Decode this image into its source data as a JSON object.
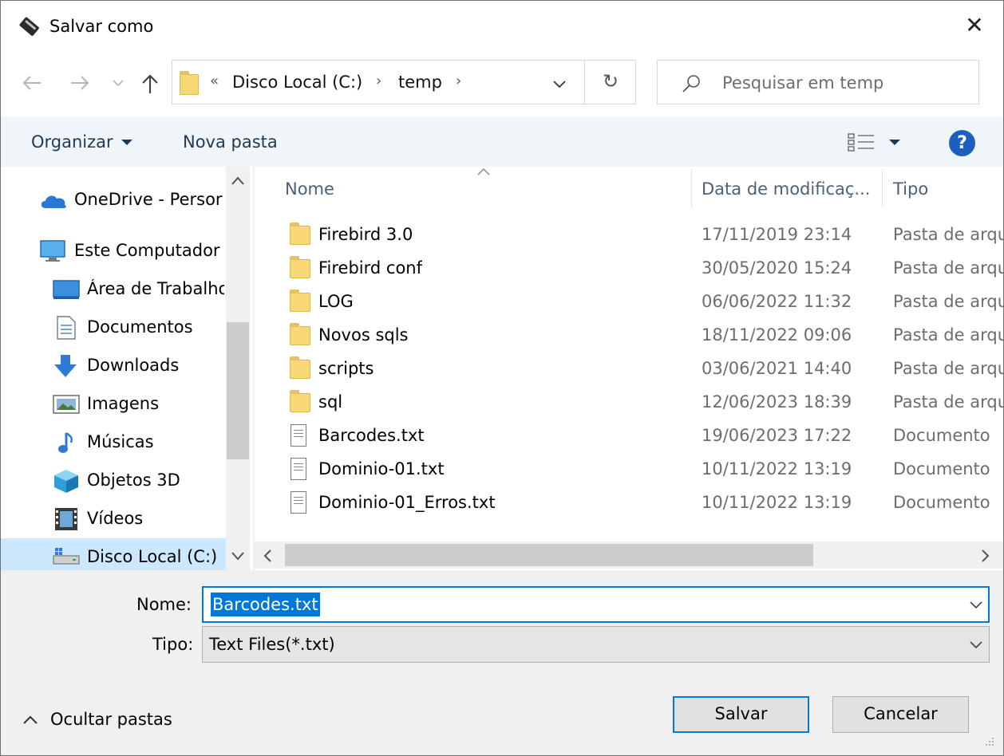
{
  "window": {
    "title": "Salvar como",
    "close_symbol": "✕"
  },
  "address": {
    "overflow": "«",
    "crumbs": [
      "Disco Local (C:)",
      "temp"
    ],
    "separator": "›",
    "refresh_symbol": "↻",
    "dropdown_symbol": "⌄"
  },
  "search": {
    "placeholder": "Pesquisar em temp"
  },
  "toolbar": {
    "organize": "Organizar",
    "new_folder": "Nova pasta",
    "help": "?"
  },
  "nav": {
    "items": [
      {
        "label": "OneDrive - Persor",
        "icon": "cloud-icon"
      },
      {
        "label": "Este Computador",
        "icon": "computer-icon"
      },
      {
        "label": "Área de Trabalho",
        "icon": "desktop-icon"
      },
      {
        "label": "Documentos",
        "icon": "documents-icon"
      },
      {
        "label": "Downloads",
        "icon": "downloads-icon"
      },
      {
        "label": "Imagens",
        "icon": "pictures-icon"
      },
      {
        "label": "Músicas",
        "icon": "music-icon"
      },
      {
        "label": "Objetos 3D",
        "icon": "objects3d-icon"
      },
      {
        "label": "Vídeos",
        "icon": "videos-icon"
      },
      {
        "label": "Disco Local (C:)",
        "icon": "drive-icon"
      }
    ]
  },
  "columns": {
    "name": "Nome",
    "date": "Data de modificaç...",
    "type": "Tipo"
  },
  "files": [
    {
      "name": "Firebird 3.0",
      "date": "17/11/2019 23:14",
      "type": "Pasta de arqu",
      "kind": "folder"
    },
    {
      "name": "Firebird conf",
      "date": "30/05/2020 15:24",
      "type": "Pasta de arqu",
      "kind": "folder"
    },
    {
      "name": "LOG",
      "date": "06/06/2022 11:32",
      "type": "Pasta de arqu",
      "kind": "folder"
    },
    {
      "name": "Novos sqls",
      "date": "18/11/2022 09:06",
      "type": "Pasta de arqu",
      "kind": "folder"
    },
    {
      "name": "scripts",
      "date": "03/06/2021 14:40",
      "type": "Pasta de arqu",
      "kind": "folder"
    },
    {
      "name": "sql",
      "date": "12/06/2023 18:39",
      "type": "Pasta de arqu",
      "kind": "folder"
    },
    {
      "name": "Barcodes.txt",
      "date": "19/06/2023 17:22",
      "type": "Documento",
      "kind": "text"
    },
    {
      "name": "Dominio-01.txt",
      "date": "10/11/2022 13:19",
      "type": "Documento",
      "kind": "text"
    },
    {
      "name": "Dominio-01_Erros.txt",
      "date": "10/11/2022 13:19",
      "type": "Documento",
      "kind": "text"
    }
  ],
  "form": {
    "name_label": "Nome:",
    "name_value": "Barcodes.txt",
    "type_label": "Tipo:",
    "type_value": "Text Files(*.txt)"
  },
  "footer": {
    "hide_folders": "Ocultar pastas",
    "save": "Salvar",
    "cancel": "Cancelar"
  },
  "colors": {
    "accent": "#0078d7",
    "folder": "#f8d775",
    "toolbar_text": "#1e3957"
  }
}
